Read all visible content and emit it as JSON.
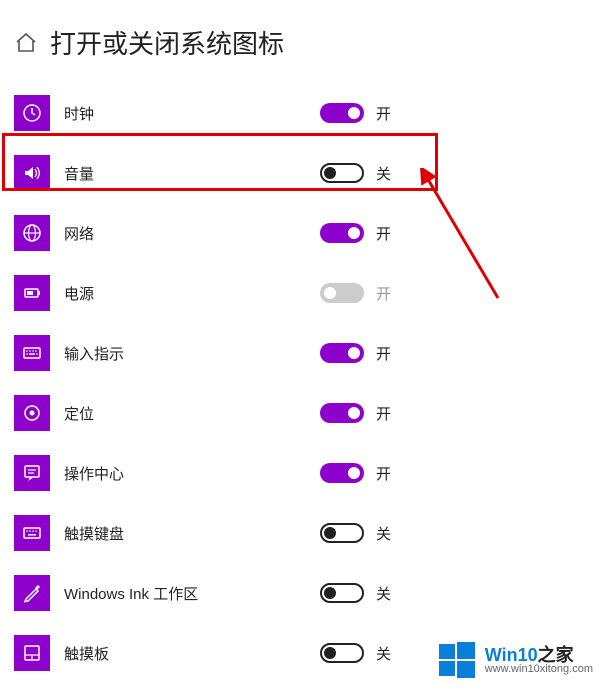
{
  "header": {
    "title": "打开或关闭系统图标"
  },
  "toggle_states": {
    "on": "开",
    "off": "关"
  },
  "items": [
    {
      "icon": "clock",
      "label": "时钟",
      "state": "on",
      "interactable": true
    },
    {
      "icon": "volume",
      "label": "音量",
      "state": "off",
      "interactable": true
    },
    {
      "icon": "network",
      "label": "网络",
      "state": "on",
      "interactable": true
    },
    {
      "icon": "power",
      "label": "电源",
      "state": "disabled",
      "interactable": false
    },
    {
      "icon": "input",
      "label": "输入指示",
      "state": "on",
      "interactable": true
    },
    {
      "icon": "location",
      "label": "定位",
      "state": "on",
      "interactable": true
    },
    {
      "icon": "action",
      "label": "操作中心",
      "state": "on",
      "interactable": true
    },
    {
      "icon": "touchkb",
      "label": "触摸键盘",
      "state": "off",
      "interactable": true
    },
    {
      "icon": "ink",
      "label": "Windows Ink 工作区",
      "state": "off",
      "interactable": true
    },
    {
      "icon": "touchpad",
      "label": "触摸板",
      "state": "off",
      "interactable": true
    }
  ],
  "annotation": {
    "highlight_index": 1
  },
  "watermark": {
    "brand1": "Win10",
    "brand2": "之家",
    "url": "www.win10xitong.com"
  }
}
